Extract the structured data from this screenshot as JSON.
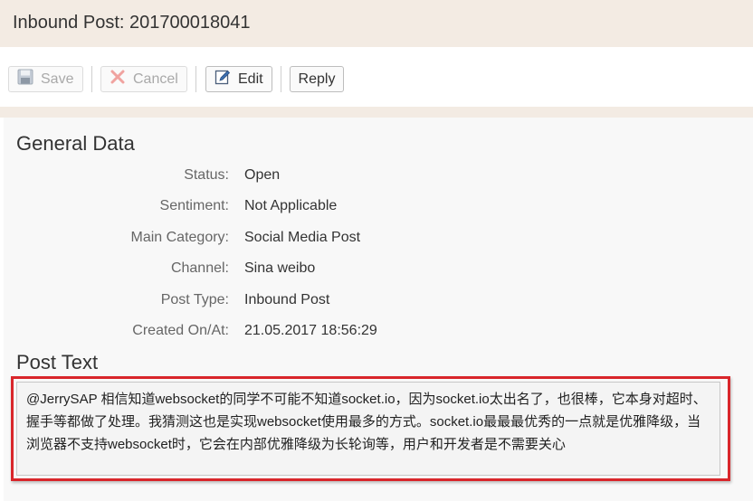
{
  "header": {
    "title": "Inbound Post: 201700018041"
  },
  "toolbar": {
    "save_label": "Save",
    "cancel_label": "Cancel",
    "edit_label": "Edit",
    "reply_label": "Reply"
  },
  "general_data": {
    "title": "General Data",
    "fields": [
      {
        "label": "Status:",
        "value": "Open"
      },
      {
        "label": "Sentiment:",
        "value": "Not Applicable"
      },
      {
        "label": "Main Category:",
        "value": "Social Media Post"
      },
      {
        "label": "Channel:",
        "value": "Sina weibo"
      },
      {
        "label": "Post Type:",
        "value": "Inbound Post"
      },
      {
        "label": "Created On/At:",
        "value": "21.05.2017 18:56:29"
      }
    ]
  },
  "post_text": {
    "title": "Post Text",
    "content": "@JerrySAP 相信知道websocket的同学不可能不知道socket.io，因为socket.io太出名了，也很棒，它本身对超时、握手等都做了处理。我猜测这也是实现websocket使用最多的方式。socket.io最最最优秀的一点就是优雅降级，当浏览器不支持websocket时，它会在内部优雅降级为长轮询等，用户和开发者是不需要关心"
  },
  "colors": {
    "title_bar_bg": "#f3ebe3",
    "highlight_border": "#d9262b"
  }
}
